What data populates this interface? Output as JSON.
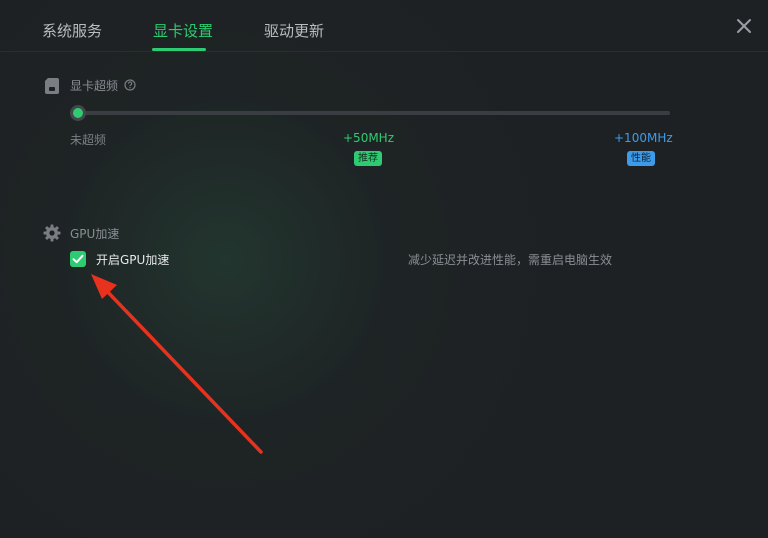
{
  "tabs": [
    {
      "label": "系统服务"
    },
    {
      "label": "显卡设置"
    },
    {
      "label": "驱动更新"
    }
  ],
  "active_tab": "显卡设置",
  "overclock": {
    "title": "显卡超频",
    "slider_value": "未超频",
    "ticks": [
      {
        "label": "未超频"
      },
      {
        "label": "+50MHz",
        "badge": "推荐"
      },
      {
        "label": "+100MHz",
        "badge": "性能"
      }
    ]
  },
  "gpu_accel": {
    "title": "GPU加速",
    "checkbox_label": "开启GPU加速",
    "checked": true,
    "hint": "减少延迟并改进性能，需重启电脑生效"
  },
  "colors": {
    "accent_green": "#2fcb72",
    "accent_blue": "#3d9be9",
    "annotation_red": "#e8321e",
    "background": "#1e2124"
  },
  "icons": [
    "close-icon",
    "sd-card-icon",
    "help-circle-icon",
    "gear-icon",
    "check-icon",
    "arrow-annotation"
  ]
}
